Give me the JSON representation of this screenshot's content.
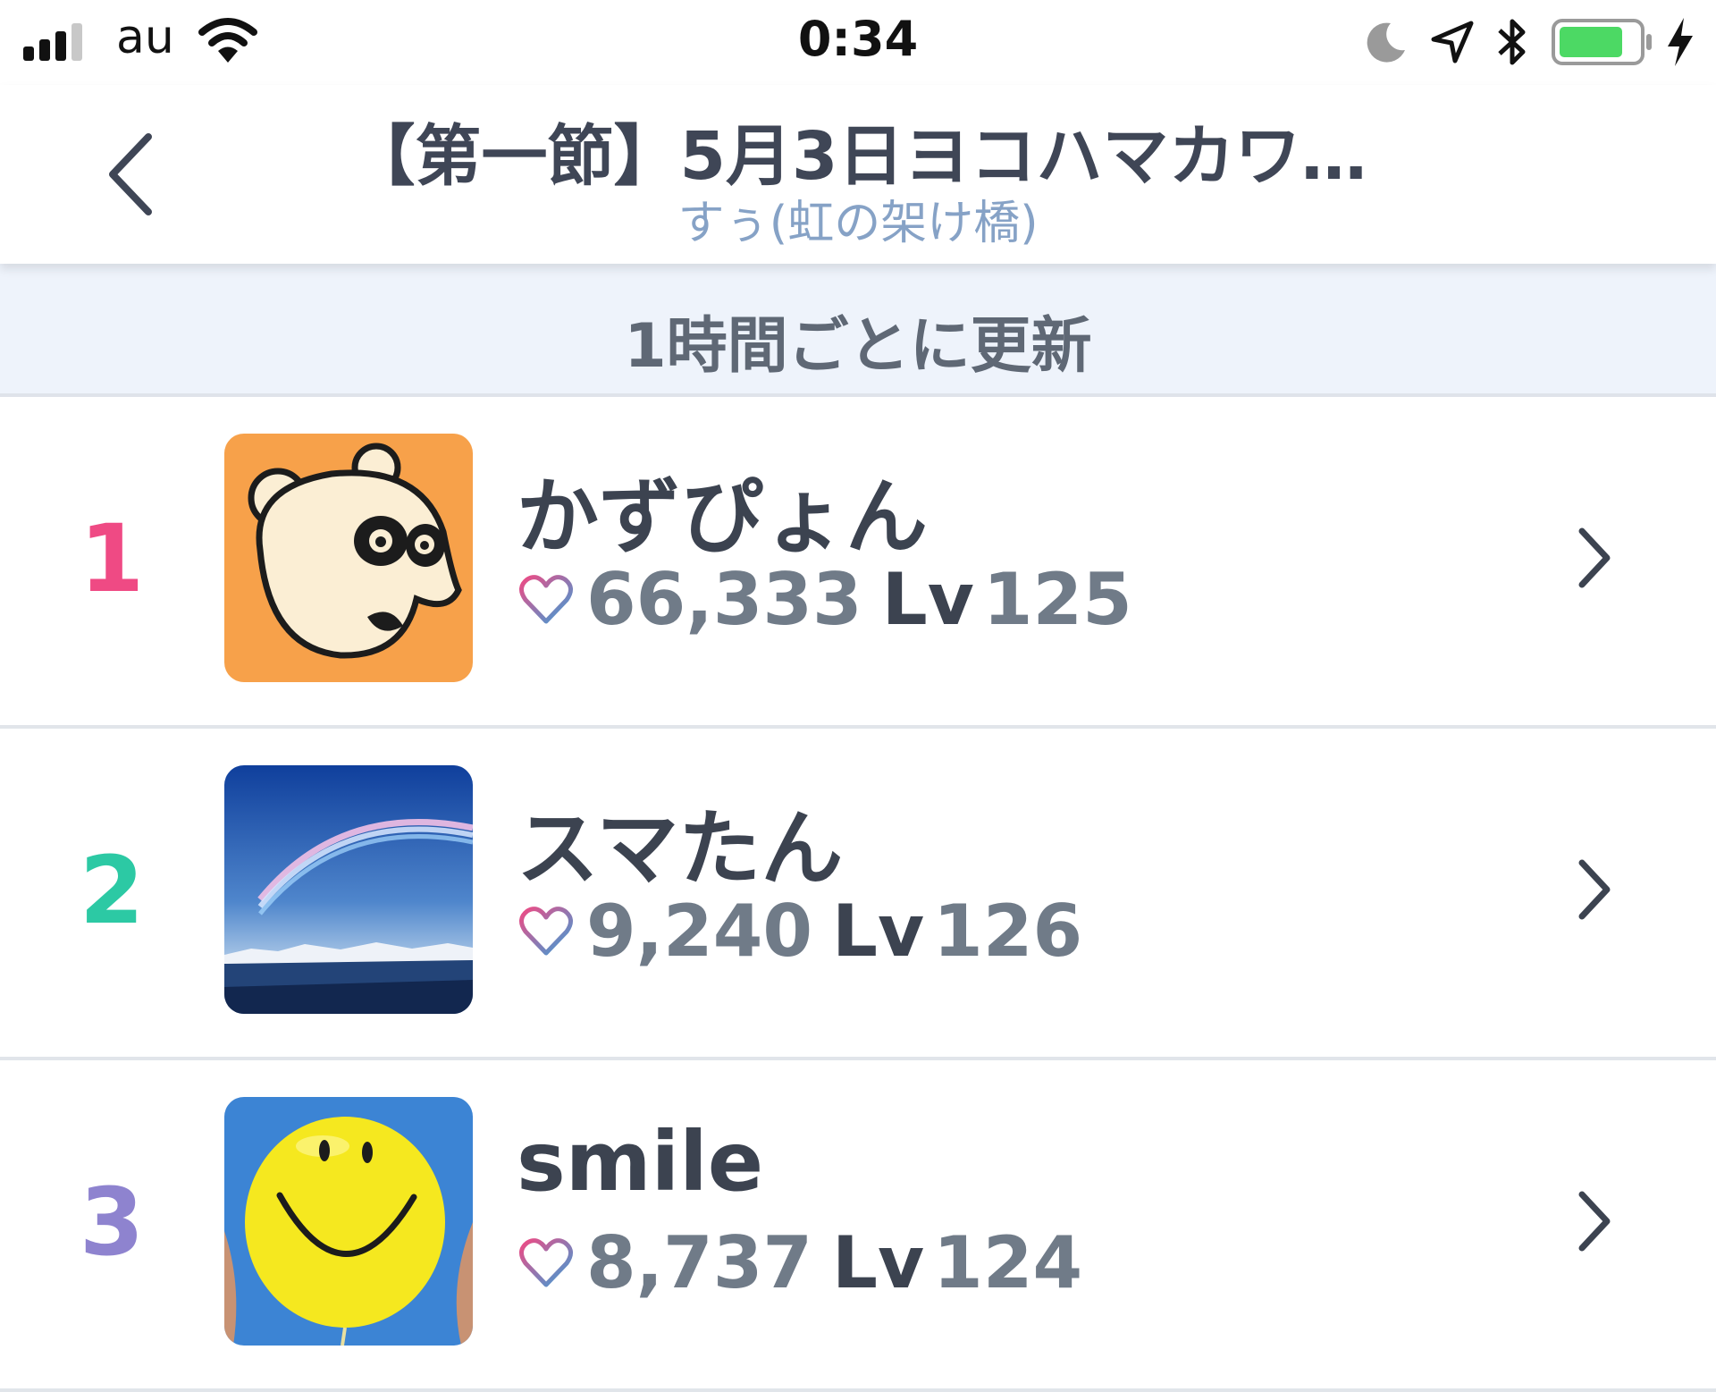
{
  "status_bar": {
    "carrier": "au",
    "time": "0:34",
    "icons": [
      "signal-icon",
      "wifi-icon",
      "moon-icon",
      "location-icon",
      "bluetooth-icon",
      "battery-icon",
      "charging-icon"
    ]
  },
  "nav": {
    "title": "【第一節】5月3日ヨコハマカワ…",
    "subtitle": "すぅ(虹の架け橋)",
    "back_icon": "chevron-left-icon"
  },
  "banner": {
    "text": "1時間ごとに更新"
  },
  "colors": {
    "rank1": "#ef4a84",
    "rank2": "#2cc9a4",
    "rank3": "#8e83cf",
    "subtitle": "#86a2c6",
    "banner_bg": "#eef3fb"
  },
  "rankings": [
    {
      "rank": "1",
      "name": "かずぴょん",
      "likes": "66,333",
      "lv_label": "Lv",
      "level": "125",
      "avatar": "cartoon-bear-avatar"
    },
    {
      "rank": "2",
      "name": "スマたん",
      "likes": "9,240",
      "lv_label": "Lv",
      "level": "126",
      "avatar": "rainbow-sky-avatar"
    },
    {
      "rank": "3",
      "name": "smile",
      "likes": "8,737",
      "lv_label": "Lv",
      "level": "124",
      "avatar": "smiley-balloon-avatar"
    }
  ]
}
